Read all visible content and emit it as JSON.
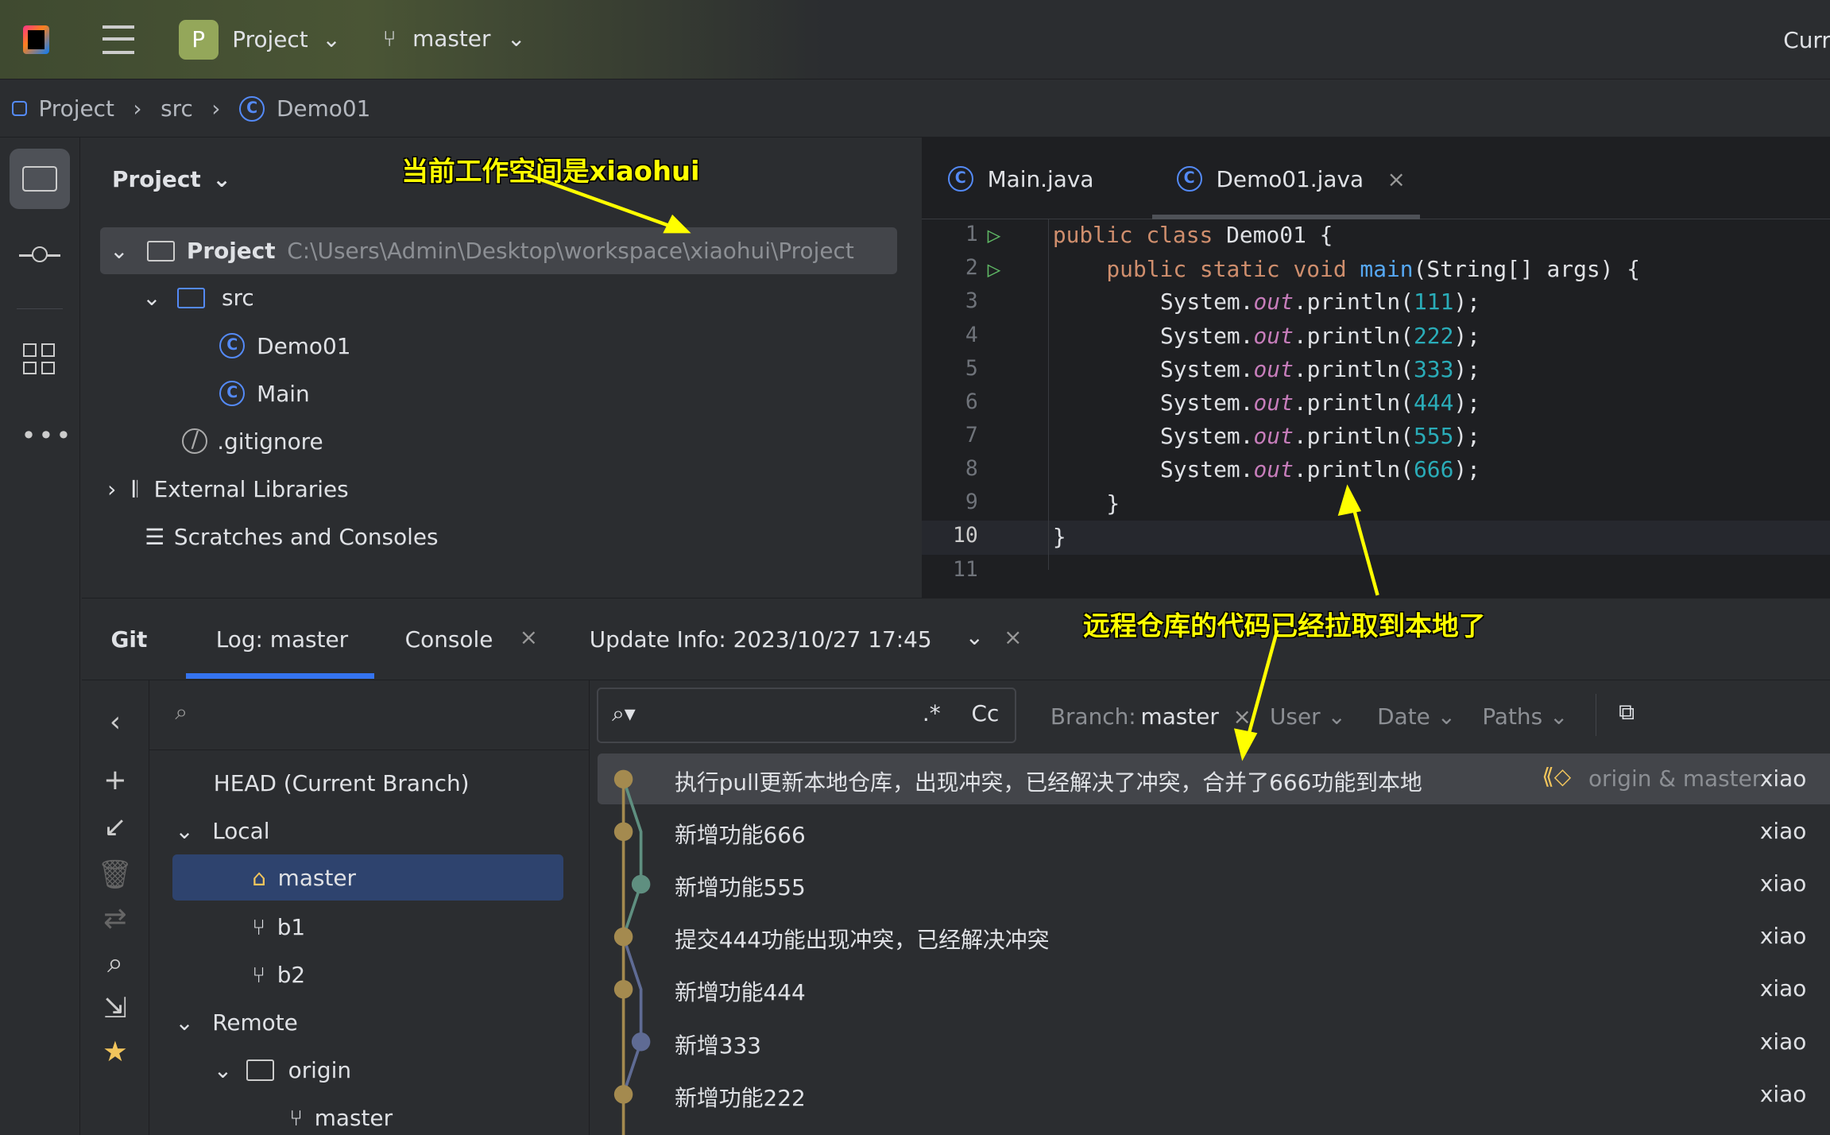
{
  "topbar": {
    "project_badge": "P",
    "project_label": "Project",
    "branch_label": "master",
    "right_text": "Curr"
  },
  "breadcrumb": [
    "Project",
    "src",
    "Demo01"
  ],
  "project_panel": {
    "title": "Project",
    "tree": [
      {
        "label": "Project",
        "path": "C:\\Users\\Admin\\Desktop\\workspace\\xiaohui\\Project"
      },
      {
        "label": "src"
      },
      {
        "label": "Demo01"
      },
      {
        "label": "Main"
      },
      {
        "label": ".gitignore"
      },
      {
        "label": "External Libraries"
      },
      {
        "label": "Scratches and Consoles"
      }
    ]
  },
  "editor": {
    "tabs": [
      {
        "label": "Main.java"
      },
      {
        "label": "Demo01.java",
        "active": true
      }
    ],
    "lines": [
      "1",
      "2",
      "3",
      "4",
      "5",
      "6",
      "7",
      "8",
      "9",
      "10",
      "11"
    ],
    "code": {
      "l1a": "public class ",
      "l1b": "Demo01 ",
      "l1c": "{",
      "l2a": "public static void ",
      "l2b": "main",
      "l2c": "(String[] args) {",
      "sys": "System.",
      "out": "out",
      ".p": ".println(",
      "vals": [
        "111",
        "222",
        "333",
        "444",
        "555",
        "666"
      ],
      "end": ");",
      "close1": "}",
      "close2": "}"
    }
  },
  "annotations": {
    "workspace": "当前工作空间是xiaohui",
    "pulled": "远程仓库的代码已经拉取到本地了"
  },
  "git": {
    "tabs": [
      "Git",
      "Log: master",
      "Console",
      "Update Info: 2023/10/27 17:45"
    ],
    "branches": {
      "head": "HEAD (Current Branch)",
      "local": "Local",
      "local_items": [
        "master",
        "b1",
        "b2"
      ],
      "remote": "Remote",
      "origin": "origin",
      "remote_items": [
        "master"
      ]
    },
    "filters": {
      "regex": ".*",
      "case": "Cc",
      "branch_label": "Branch: ",
      "branch_value": "master",
      "user": "User",
      "date": "Date",
      "paths": "Paths"
    },
    "commits": [
      {
        "message": "执行pull更新本地仓库，出现冲突，已经解决了冲突，合并了666功能到本地",
        "refs": "origin & master",
        "author": "xiao"
      },
      {
        "message": "新增功能666",
        "author": "xiao"
      },
      {
        "message": "新增功能555",
        "author": "xiao"
      },
      {
        "message": "提交444功能出现冲突，已经解决冲突",
        "author": "xiao"
      },
      {
        "message": "新增功能444",
        "author": "xiao"
      },
      {
        "message": "新增333",
        "author": "xiao"
      },
      {
        "message": "新增功能222",
        "author": "xiao"
      }
    ],
    "colors": {
      "main": "#a48a4f",
      "green": "#5f8f80",
      "blue": "#5f6b94"
    }
  }
}
